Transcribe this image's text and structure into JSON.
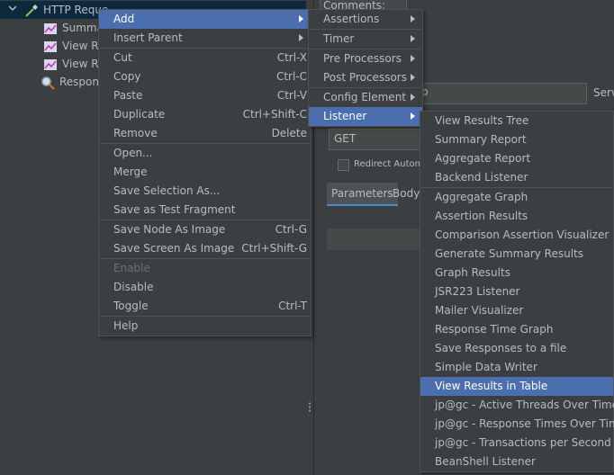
{
  "tree": {
    "items": [
      {
        "label": "HTTP Reque",
        "icon": "pipette-icon"
      },
      {
        "label": "Summa",
        "icon": "chart-icon"
      },
      {
        "label": "View Re",
        "icon": "chart-icon"
      },
      {
        "label": "View Re",
        "icon": "chart-icon"
      },
      {
        "label": "Respon",
        "icon": "magnifier-icon"
      }
    ]
  },
  "right_panel": {
    "comments_label": "Comments:",
    "server_label": "Serv",
    "path_fragment": "p",
    "method_value": "GET",
    "redirect_label": "Redirect Automa",
    "tabs": [
      "Parameters",
      "Body"
    ]
  },
  "main_menu": {
    "items": [
      {
        "label": "Add",
        "accel": "",
        "submenu": true
      },
      {
        "label": "Insert Parent",
        "accel": "",
        "submenu": true
      },
      {
        "label": "Cut",
        "accel": "Ctrl-X"
      },
      {
        "label": "Copy",
        "accel": "Ctrl-C"
      },
      {
        "label": "Paste",
        "accel": "Ctrl-V"
      },
      {
        "label": "Duplicate",
        "accel": "Ctrl+Shift-C"
      },
      {
        "label": "Remove",
        "accel": "Delete"
      },
      {
        "label": "Open...",
        "accel": ""
      },
      {
        "label": "Merge",
        "accel": ""
      },
      {
        "label": "Save Selection As...",
        "accel": ""
      },
      {
        "label": "Save as Test Fragment",
        "accel": ""
      },
      {
        "label": "Save Node As Image",
        "accel": "Ctrl-G"
      },
      {
        "label": "Save Screen As Image",
        "accel": "Ctrl+Shift-G"
      },
      {
        "label": "Enable",
        "accel": ""
      },
      {
        "label": "Disable",
        "accel": ""
      },
      {
        "label": "Toggle",
        "accel": "Ctrl-T"
      },
      {
        "label": "Help",
        "accel": ""
      }
    ]
  },
  "add_menu": {
    "items": [
      "Assertions",
      "Timer",
      "Pre Processors",
      "Post Processors",
      "Config Element",
      "Listener"
    ]
  },
  "listener_menu": {
    "items": [
      "View Results Tree",
      "Summary Report",
      "Aggregate Report",
      "Backend Listener",
      "Aggregate Graph",
      "Assertion Results",
      "Comparison Assertion Visualizer",
      "Generate Summary Results",
      "Graph Results",
      "JSR223 Listener",
      "Mailer Visualizer",
      "Response Time Graph",
      "Save Responses to a file",
      "Simple Data Writer",
      "View Results in Table",
      "jp@gc - Active Threads Over Time",
      "jp@gc - Response Times Over Time",
      "jp@gc - Transactions per Second",
      "BeanShell Listener"
    ]
  },
  "colors": {
    "background": "#3c3f41",
    "highlight": "#4b6eaf",
    "text": "#bbbbbb",
    "disabled_text": "#6e6e6e"
  }
}
